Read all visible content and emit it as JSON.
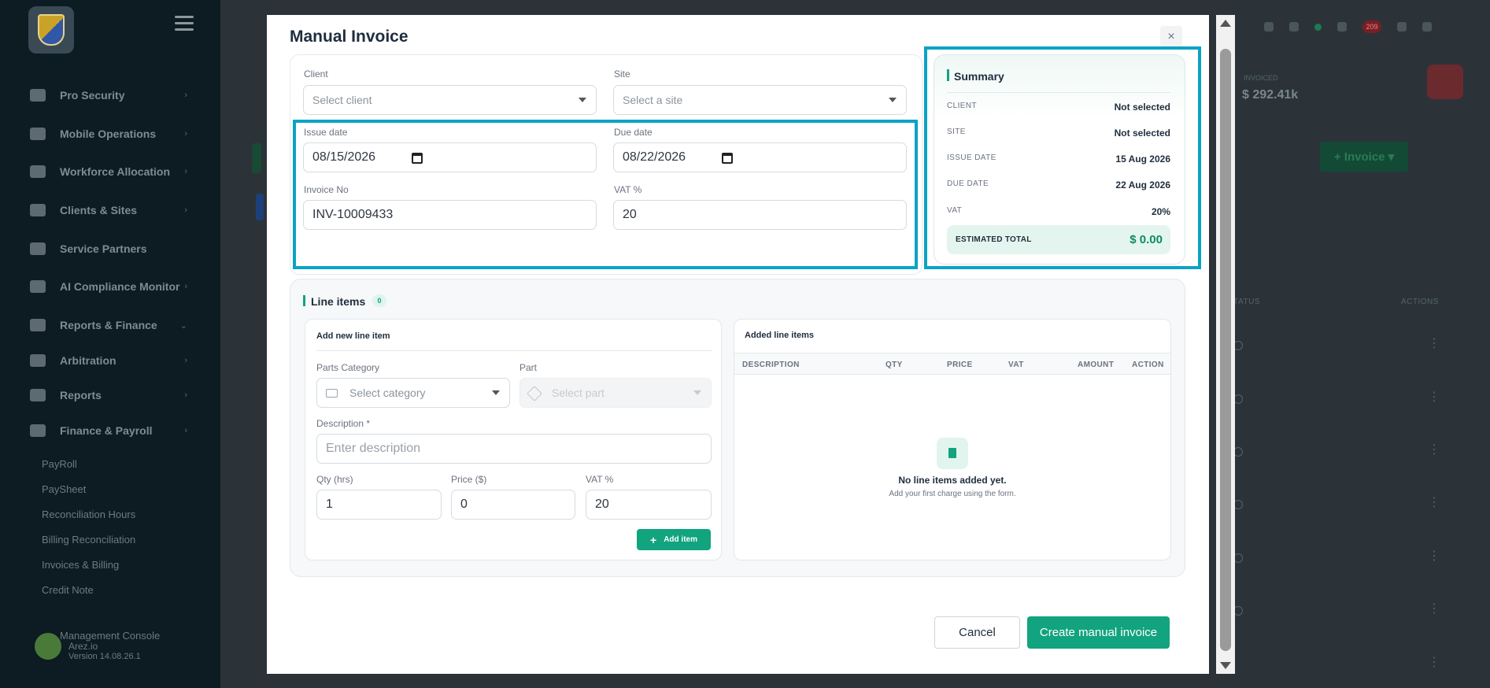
{
  "sidebar": {
    "items": [
      {
        "label": "Pro Security"
      },
      {
        "label": "Mobile Operations"
      },
      {
        "label": "Workforce Allocation"
      },
      {
        "label": "Clients & Sites"
      },
      {
        "label": "Service Partners"
      },
      {
        "label": "AI Compliance Monitor"
      },
      {
        "label": "Reports & Finance"
      },
      {
        "label": "Arbitration"
      },
      {
        "label": "Reports"
      },
      {
        "label": "Finance & Payroll"
      }
    ],
    "subitems": [
      {
        "label": "PayRoll"
      },
      {
        "label": "PaySheet"
      },
      {
        "label": "Reconciliation Hours"
      },
      {
        "label": "Billing Reconciliation"
      },
      {
        "label": "Invoices & Billing"
      },
      {
        "label": "Credit Note"
      }
    ],
    "console": {
      "title": "Management Console",
      "name": "Arez.io",
      "version": "Version 14.08.26.1"
    }
  },
  "background": {
    "notification_count": "209",
    "kpi": {
      "label": "INVOICED",
      "value": "$ 292.41k"
    },
    "invoice_button": "+ Invoice ▾",
    "columns": {
      "status": "STATUS",
      "actions": "ACTIONS"
    }
  },
  "modal": {
    "title": "Manual Invoice",
    "close": "×",
    "client": {
      "label": "Client",
      "placeholder": "Select client"
    },
    "site": {
      "label": "Site",
      "placeholder": "Select a site"
    },
    "issue_date": {
      "label": "Issue date",
      "value": "08/15/2026"
    },
    "due_date": {
      "label": "Due date",
      "value": "08/22/2026"
    },
    "invoice_no": {
      "label": "Invoice No",
      "value": "INV-10009433"
    },
    "vat": {
      "label": "VAT %",
      "value": "20"
    },
    "summary": {
      "title": "Summary",
      "rows": [
        {
          "key": "CLIENT",
          "value": "Not selected"
        },
        {
          "key": "SITE",
          "value": "Not selected"
        },
        {
          "key": "ISSUE DATE",
          "value": "15 Aug 2026"
        },
        {
          "key": "DUE DATE",
          "value": "22 Aug 2026"
        },
        {
          "key": "VAT",
          "value": "20%"
        }
      ],
      "total_label": "ESTIMATED TOTAL",
      "total_value": "$ 0.00"
    },
    "line_items": {
      "title": "Line items",
      "count": "0",
      "add": {
        "title": "Add new line item",
        "parts_category": {
          "label": "Parts Category",
          "placeholder": "Select category"
        },
        "part": {
          "label": "Part",
          "placeholder": "Select part"
        },
        "description": {
          "label": "Description *",
          "placeholder": "Enter description"
        },
        "qty": {
          "label": "Qty (hrs)",
          "value": "1"
        },
        "price": {
          "label": "Price ($)",
          "value": "0"
        },
        "vat": {
          "label": "VAT %",
          "value": "20"
        },
        "add_button": "Add item"
      },
      "added": {
        "title": "Added line items",
        "columns": [
          "DESCRIPTION",
          "QTY",
          "PRICE",
          "VAT",
          "AMOUNT",
          "ACTION"
        ],
        "empty_title": "No line items added yet.",
        "empty_sub": "Add your first charge using the form."
      }
    },
    "cancel": "Cancel",
    "create": "Create manual invoice"
  }
}
